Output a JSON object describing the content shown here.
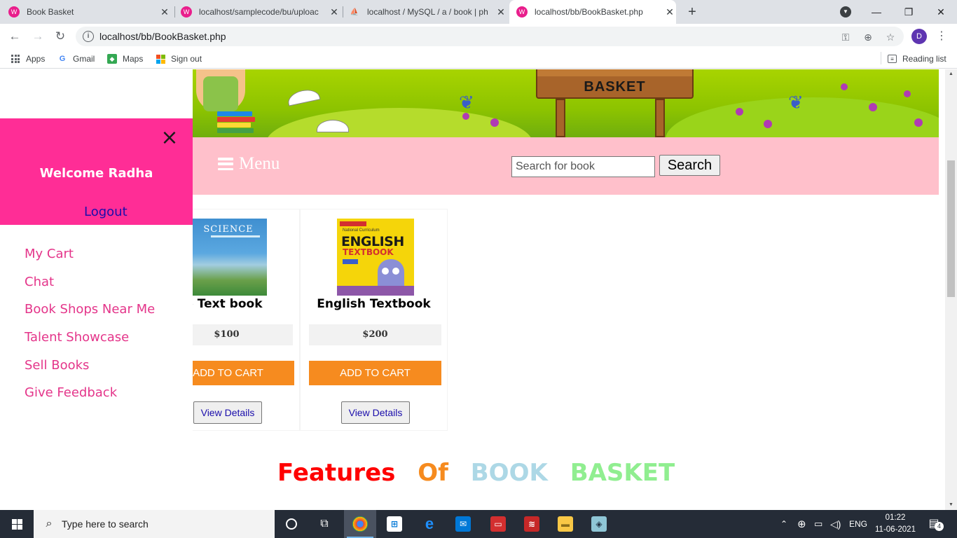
{
  "browser": {
    "tabs": [
      {
        "title": "Book Basket",
        "favicon": "wamp-icon"
      },
      {
        "title": "localhost/samplecode/bu/uploac",
        "favicon": "wamp-icon"
      },
      {
        "title": "localhost / MySQL / a / book | ph",
        "favicon": "phpmyadmin-icon"
      },
      {
        "title": "localhost/bb/BookBasket.php",
        "favicon": "wamp-icon"
      }
    ],
    "active_tab_index": 3,
    "url": "localhost/bb/BookBasket.php",
    "profile_initial": "D",
    "bookmarks": [
      {
        "label": "Apps",
        "icon": "apps-grid-icon"
      },
      {
        "label": "Gmail",
        "icon": "google-icon"
      },
      {
        "label": "Maps",
        "icon": "maps-icon"
      },
      {
        "label": "Sign out",
        "icon": "microsoft-icon"
      }
    ],
    "reading_list": "Reading list"
  },
  "banner": {
    "sign_text": "BASKET"
  },
  "menubar": {
    "menu_label": "Menu",
    "search_placeholder": "Search for book",
    "search_button": "Search"
  },
  "sidenav": {
    "close_glyph": "×",
    "welcome": "Welcome Radha",
    "logout": "Logout",
    "links": [
      "My Cart",
      "Chat",
      "Book Shops Near Me",
      "Talent Showcase",
      "Sell Books",
      "Give Feedback"
    ]
  },
  "products": [
    {
      "title": "Science Text book",
      "price": "$100",
      "cover_label": "SCIENCE",
      "add_to_cart": "ADD TO CART",
      "view_details": "View Details"
    },
    {
      "title": "English Textbook",
      "price": "$200",
      "cover_label": "ENGLISH",
      "cover_sub": "TEXTBOOK",
      "cover_top": "National Curriculum",
      "add_to_cart": "ADD TO CART",
      "view_details": "View Details"
    }
  ],
  "features_heading": [
    {
      "word": "Features",
      "color": "#ff0000"
    },
    {
      "word": "Of",
      "color": "#f68b1f"
    },
    {
      "word": "BOOK",
      "color": "#add8e6"
    },
    {
      "word": "BASKET",
      "color": "#90ee90"
    }
  ],
  "taskbar": {
    "search_placeholder": "Type here to search",
    "language": "ENG",
    "time": "01:22",
    "date": "11-06-2021",
    "notification_count": "4"
  },
  "colors": {
    "menubar_bg": "#ffc0cb",
    "sidenav_header_bg": "#ff2d96",
    "sidenav_link": "#e4358a",
    "cart_button": "#f68b1f"
  }
}
